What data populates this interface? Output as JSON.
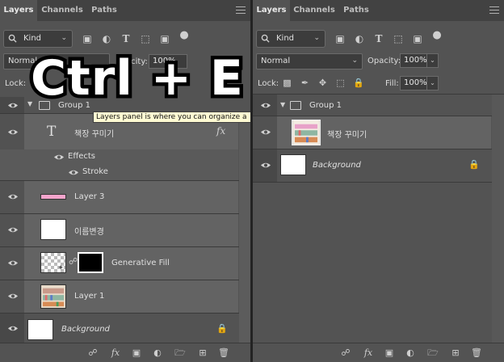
{
  "colors": {
    "panel": "#535353",
    "tab_bar": "#424242",
    "selected_row": "#636363",
    "tooltip": "#fffbd3",
    "layer3_swatch": "#f4a4cc"
  },
  "tabs": [
    "Layers",
    "Channels",
    "Paths"
  ],
  "filter": {
    "label": "Kind"
  },
  "blend_mode": "Normal",
  "opacity": {
    "label": "Opacity:",
    "value": "100%"
  },
  "lock": {
    "label": "Lock:"
  },
  "fill": {
    "label": "Fill:",
    "value": "100%"
  },
  "left": {
    "opacity_partial": "acity:",
    "lock_label": "Lock:",
    "group_partial": "Group 1",
    "text_layer": "책장 꾸미기",
    "effects": "Effects",
    "stroke": "Stroke",
    "layer3": "Layer 3",
    "rename_layer": "이름변경",
    "generative_fill": "Generative Fill",
    "layer1": "Layer 1",
    "background": "Background"
  },
  "tooltip": "Layers panel is where you can organize a",
  "overlay": "Ctrl + E",
  "right": {
    "group": "Group 1",
    "merged_layer": "책장 꾸미기",
    "background": "Background"
  },
  "icons": [
    "search-icon",
    "image-filter-icon",
    "adjustment-filter-icon",
    "type-filter-icon",
    "shape-filter-icon",
    "smart-object-filter-icon",
    "filter-toggle-icon",
    "menu-icon",
    "eye-icon",
    "lock-icon",
    "link-icon",
    "fx-icon",
    "mask-icon",
    "adjustment-icon",
    "folder-icon",
    "new-layer-icon",
    "trash-icon"
  ]
}
